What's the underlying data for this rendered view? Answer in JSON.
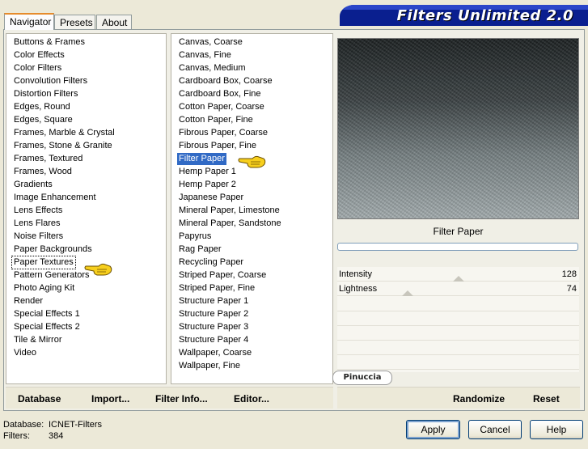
{
  "tabs": [
    "Navigator",
    "Presets",
    "About"
  ],
  "app_title": "Filters Unlimited 2.0",
  "categories": {
    "selected_index": 17,
    "items": [
      "Buttons & Frames",
      "Color Effects",
      "Color Filters",
      "Convolution Filters",
      "Distortion Filters",
      "Edges, Round",
      "Edges, Square",
      "Frames, Marble & Crystal",
      "Frames, Stone & Granite",
      "Frames, Textured",
      "Frames, Wood",
      "Gradients",
      "Image Enhancement",
      "Lens Effects",
      "Lens Flares",
      "Noise Filters",
      "Paper Backgrounds",
      "Paper Textures",
      "Pattern Generators",
      "Photo Aging Kit",
      "Render",
      "Special Effects 1",
      "Special Effects 2",
      "Tile & Mirror",
      "Video"
    ]
  },
  "filters": {
    "selected_index": 9,
    "items": [
      "Canvas, Coarse",
      "Canvas, Fine",
      "Canvas, Medium",
      "Cardboard Box, Coarse",
      "Cardboard Box, Fine",
      "Cotton Paper, Coarse",
      "Cotton Paper, Fine",
      "Fibrous Paper, Coarse",
      "Fibrous Paper, Fine",
      "Filter Paper",
      "Hemp Paper 1",
      "Hemp Paper 2",
      "Japanese Paper",
      "Mineral Paper, Limestone",
      "Mineral Paper, Sandstone",
      "Papyrus",
      "Rag Paper",
      "Recycling Paper",
      "Striped Paper, Coarse",
      "Striped Paper, Fine",
      "Structure Paper 1",
      "Structure Paper 2",
      "Structure Paper 3",
      "Structure Paper 4",
      "Wallpaper, Coarse",
      "Wallpaper, Fine"
    ]
  },
  "preview": {
    "filter_name": "Filter Paper",
    "progress": 0
  },
  "params": [
    {
      "label": "Intensity",
      "value": "128",
      "fraction": 0.5
    },
    {
      "label": "Lightness",
      "value": "74",
      "fraction": 0.29
    }
  ],
  "watermark": "Pinuccia",
  "links": [
    "Database",
    "Import...",
    "Filter Info...",
    "Editor...",
    "Randomize",
    "Reset"
  ],
  "status": {
    "database_label": "Database:",
    "database_value": "ICNET-Filters",
    "filters_label": "Filters:",
    "filters_value": "384"
  },
  "buttons": [
    "Apply",
    "Cancel",
    "Help"
  ],
  "colors": {
    "banner": "#0a1f8f",
    "selection": "#316ac5",
    "tab_accent": "#e68b2c",
    "pointer_hand": "#f2c31a"
  },
  "icons": [
    "pointing-hand-icon"
  ]
}
